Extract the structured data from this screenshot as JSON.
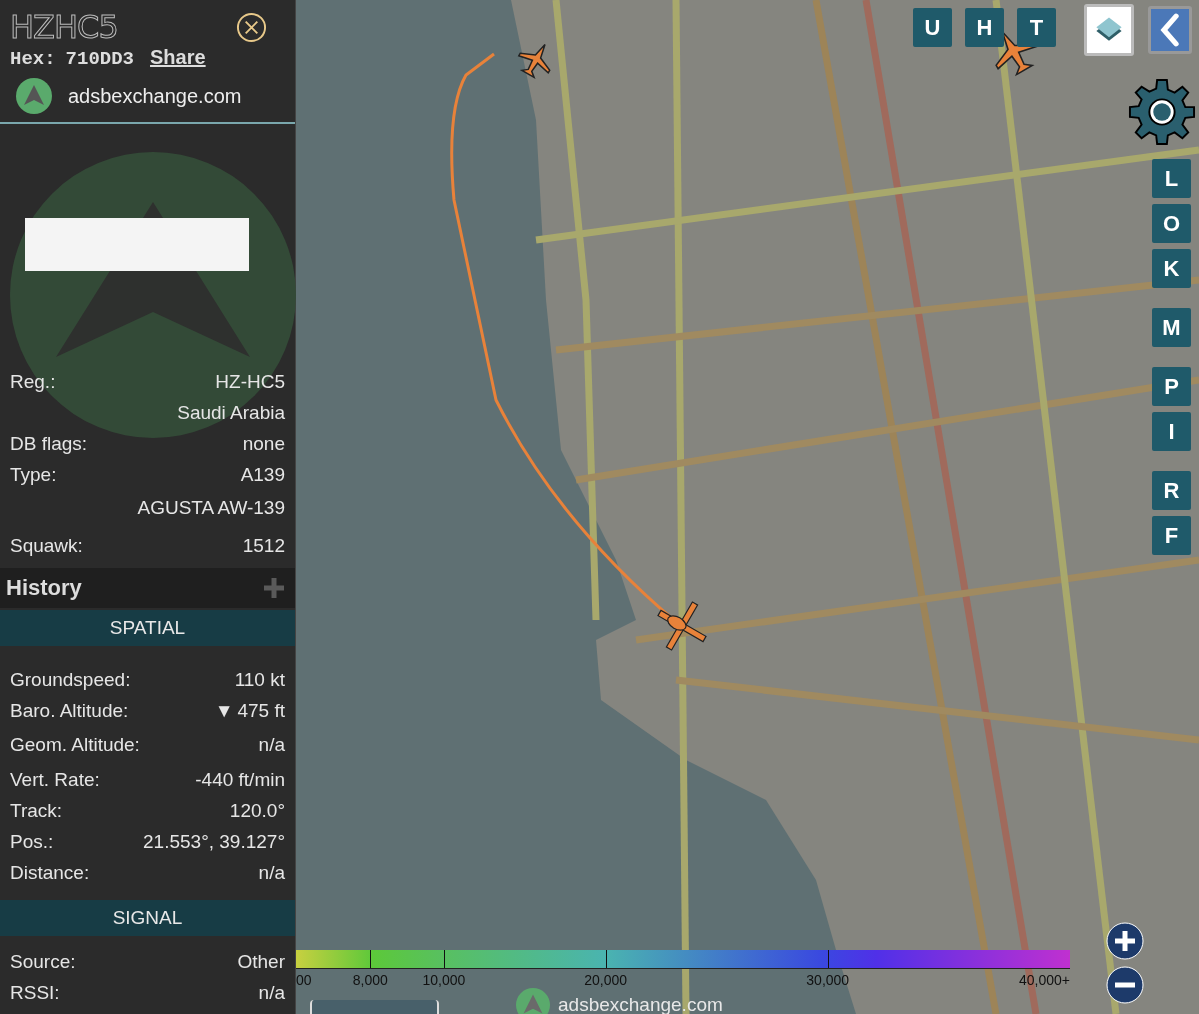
{
  "panel": {
    "callsign": "HZHC5",
    "hex_label": "Hex:",
    "hex": "710DD3",
    "share_link": "Share",
    "site": "adsbexchange.com"
  },
  "details": [
    {
      "label": "Reg.:",
      "value": "HZ-HC5"
    },
    {
      "value": "Saudi Arabia"
    },
    {
      "label": "DB flags:",
      "value": "none"
    },
    {
      "label": "Type:",
      "value": "A139"
    },
    {
      "value": "AGUSTA AW-139"
    },
    {
      "label": "Squawk:",
      "value": "1512"
    }
  ],
  "history": {
    "title": "History"
  },
  "spatial": {
    "title": "SPATIAL",
    "rows": [
      {
        "label": "Groundspeed:",
        "value": "110 kt"
      },
      {
        "label": "Baro. Altitude:",
        "trend": "▼",
        "value": "475 ft"
      },
      {
        "label": "Geom. Altitude:",
        "value": "n/a"
      },
      {
        "label": "Vert. Rate:",
        "value": "-440 ft/min"
      },
      {
        "label": "Track:",
        "value": "120.0°"
      },
      {
        "label": "Pos.:",
        "value": "21.553°, 39.127°"
      },
      {
        "label": "Distance:",
        "value": "n/a"
      }
    ]
  },
  "signal": {
    "title": "SIGNAL",
    "rows": [
      {
        "label": "Source:",
        "value": "Other"
      },
      {
        "label": "RSSI:",
        "value": "n/a"
      }
    ]
  },
  "map": {
    "top_buttons": [
      "U",
      "H",
      "T"
    ],
    "side_buttons": [
      "L",
      "O",
      "K",
      "M",
      "P",
      "I",
      "R",
      "F"
    ],
    "legend": [
      "00",
      "8,000",
      "10,000",
      "20,000",
      "30,000",
      "40,000+"
    ],
    "site": "adsbexchange.com"
  }
}
